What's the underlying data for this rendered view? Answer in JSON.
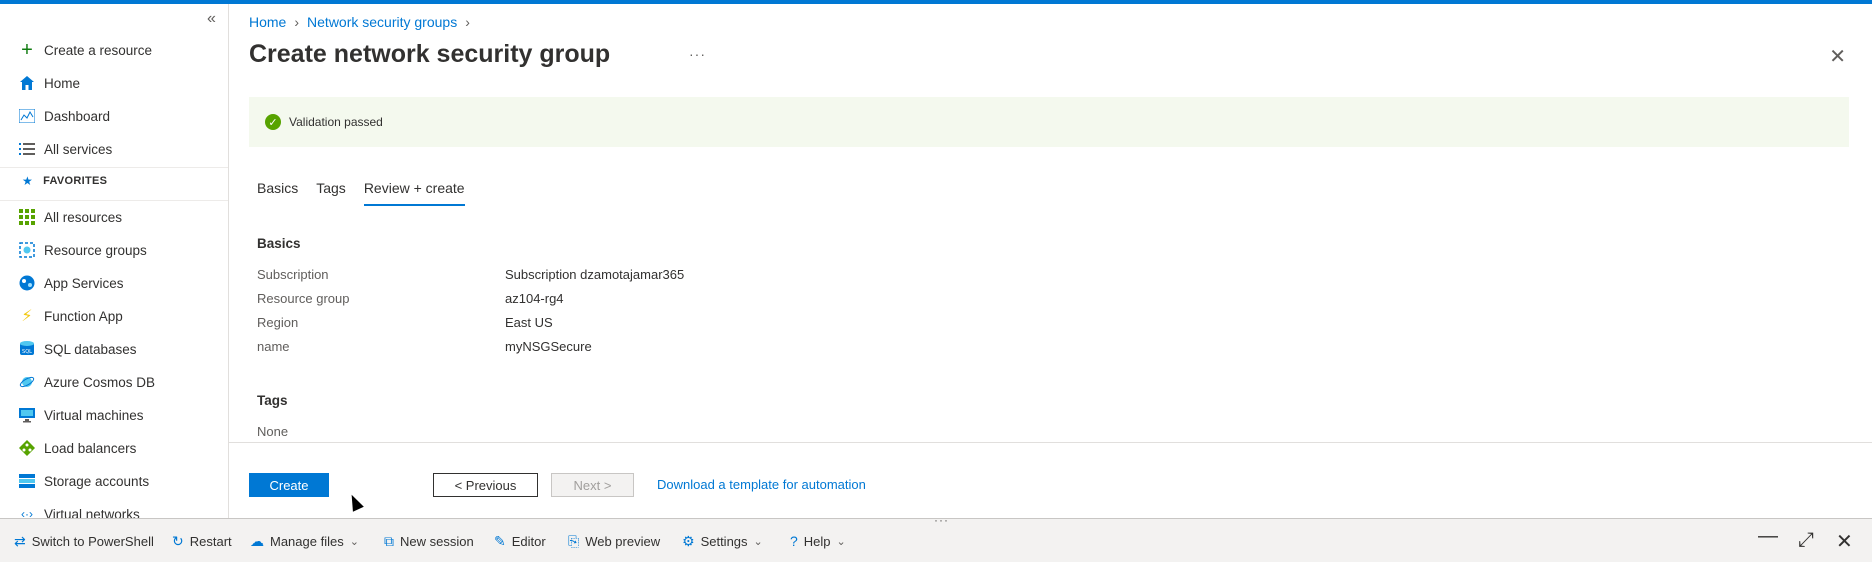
{
  "sidebar": {
    "collapse_icon": "«",
    "items": [
      {
        "label": "Create a resource",
        "icon": "plus-icon"
      },
      {
        "label": "Home",
        "icon": "home-icon"
      },
      {
        "label": "Dashboard",
        "icon": "dashboard-icon"
      },
      {
        "label": "All services",
        "icon": "list-icon"
      },
      {
        "label": "All resources",
        "icon": "grid-icon"
      },
      {
        "label": "Resource groups",
        "icon": "resource-group-icon"
      },
      {
        "label": "App Services",
        "icon": "app-services-icon"
      },
      {
        "label": "Function App",
        "icon": "function-app-icon"
      },
      {
        "label": "SQL databases",
        "icon": "sql-icon"
      },
      {
        "label": "Azure Cosmos DB",
        "icon": "cosmos-icon"
      },
      {
        "label": "Virtual machines",
        "icon": "vm-icon"
      },
      {
        "label": "Load balancers",
        "icon": "load-balancer-icon"
      },
      {
        "label": "Storage accounts",
        "icon": "storage-icon"
      },
      {
        "label": "Virtual networks",
        "icon": "vnet-icon"
      }
    ],
    "favorites_label": "FAVORITES"
  },
  "breadcrumb": {
    "home": "Home",
    "parent": "Network security groups"
  },
  "page": {
    "title": "Create network security group",
    "more": "···",
    "validation": "Validation passed"
  },
  "tabs": [
    "Basics",
    "Tags",
    "Review + create"
  ],
  "basics": {
    "heading": "Basics",
    "rows": [
      {
        "key": "Subscription",
        "value": "Subscription dzamotajamar365"
      },
      {
        "key": "Resource group",
        "value": "az104-rg4"
      },
      {
        "key": "Region",
        "value": "East US"
      },
      {
        "key": "name",
        "value": "myNSGSecure"
      }
    ]
  },
  "tags": {
    "heading": "Tags",
    "value": "None"
  },
  "footer": {
    "create": "Create",
    "previous": "< Previous",
    "next": "Next >",
    "download": "Download a template for automation"
  },
  "shell": {
    "switch": "Switch to PowerShell",
    "restart": "Restart",
    "manage_files": "Manage files",
    "new_session": "New session",
    "editor": "Editor",
    "web_preview": "Web preview",
    "settings": "Settings",
    "help": "Help"
  },
  "colors": {
    "accent": "#0078d4",
    "success": "#57a300",
    "validation_bg": "#f4f9ee"
  }
}
